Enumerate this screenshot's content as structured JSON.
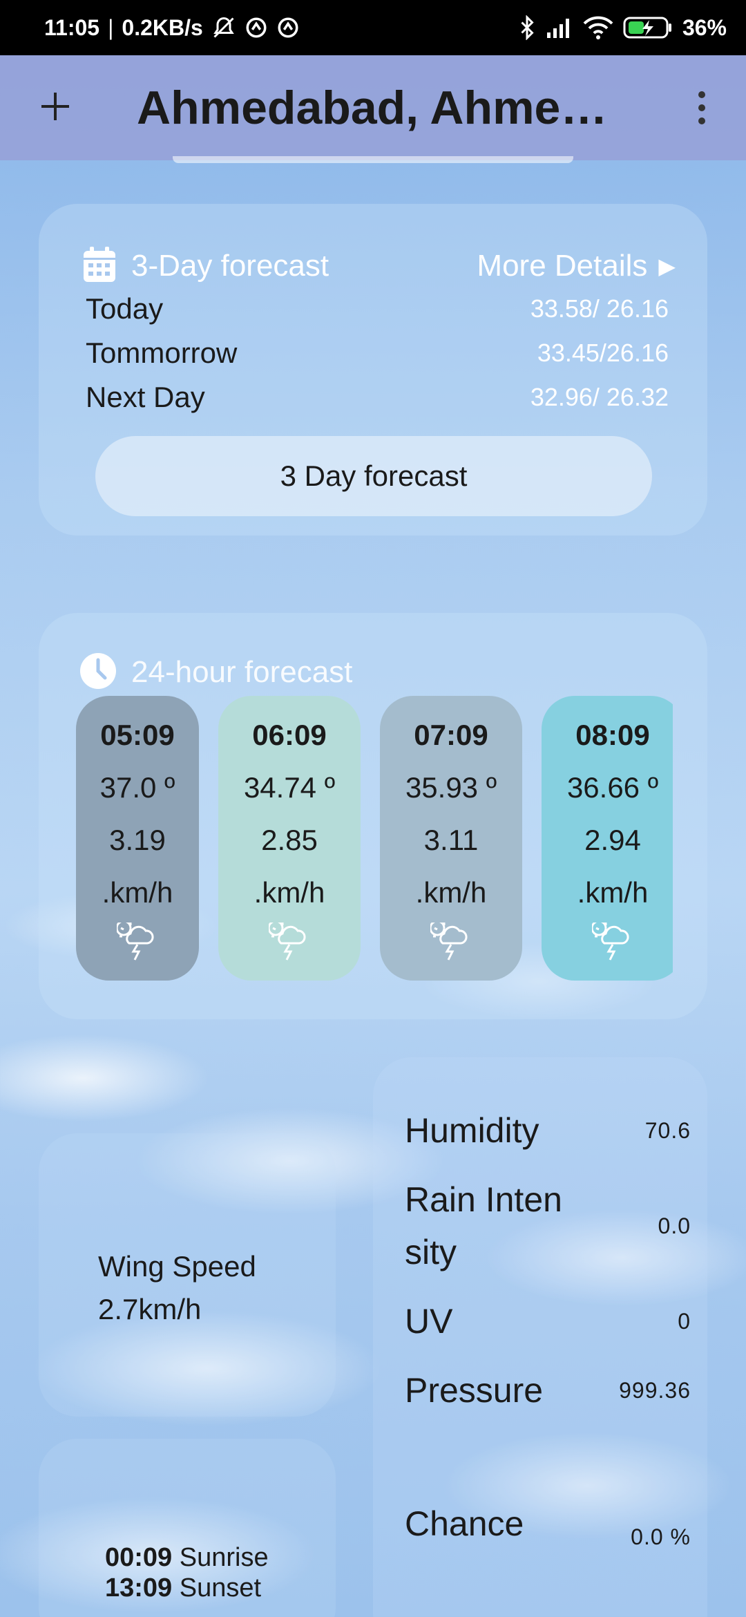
{
  "status_bar": {
    "time": "11:05",
    "net_speed": "0.2KB/s",
    "battery": "36%",
    "icons": [
      "mute-alarm-icon",
      "vpn-icon",
      "vpn-icon",
      "bluetooth-icon",
      "signal-icon",
      "wifi-icon",
      "battery-charging-icon"
    ]
  },
  "app_bar": {
    "title": "Ahmedabad, Ahmed…",
    "add_icon": "plus-icon",
    "menu_icon": "more-vert-icon"
  },
  "forecast_3day": {
    "title": "3-Day forecast",
    "more_details": "More Details",
    "rows": [
      {
        "day": "Today",
        "temps": "33.58/ 26.16"
      },
      {
        "day": "Tommorrow",
        "temps": "33.45/26.16"
      },
      {
        "day": "Next Day",
        "temps": "32.96/ 26.32"
      }
    ],
    "button_label": "3 Day forecast"
  },
  "forecast_24h": {
    "title": "24-hour forecast",
    "hours": [
      {
        "time": "05:09",
        "temp": "37.0 º",
        "wind": "3.19",
        "unit": ".km/h",
        "icon": "thunderstorm-sun-icon",
        "color": "#8ea3b6"
      },
      {
        "time": "06:09",
        "temp": "34.74 º",
        "wind": "2.85",
        "unit": ".km/h",
        "icon": "thunderstorm-sun-icon",
        "color": "#b5dcd9"
      },
      {
        "time": "07:09",
        "temp": "35.93 º",
        "wind": "3.11",
        "unit": ".km/h",
        "icon": "thunderstorm-sun-icon",
        "color": "#a4bccd"
      },
      {
        "time": "08:09",
        "temp": "36.66 º",
        "wind": "2.94",
        "unit": ".km/h",
        "icon": "thunderstorm-sun-icon",
        "color": "#86d0e0"
      }
    ]
  },
  "wind": {
    "label": "Wing Speed",
    "value": "2.7km/h"
  },
  "sun": {
    "sunrise_time": "00:09",
    "sunrise_label": "Sunrise",
    "sunset_time": "13:09",
    "sunset_label": "Sunset"
  },
  "details": [
    {
      "label": "Humidity",
      "value": "70.6"
    },
    {
      "label": "Rain Intensity",
      "value": "0.0"
    },
    {
      "label": "UV",
      "value": "0"
    },
    {
      "label": "Pressure",
      "value": "999.36"
    },
    {
      "label": "Chance",
      "value": "0.0 %"
    }
  ]
}
